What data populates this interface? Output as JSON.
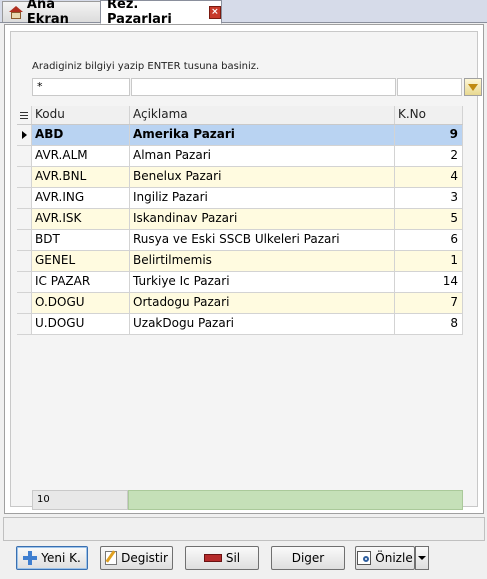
{
  "tabs": [
    {
      "label": "Ana Ekran",
      "icon": "home-icon"
    },
    {
      "label": "Rez. Pazarlari",
      "icon": "close-icon"
    }
  ],
  "search": {
    "hint": "Aradiginiz bilgiyi yazip ENTER tusuna basiniz.",
    "filter1": "*",
    "filter2": "",
    "filter3": ""
  },
  "grid": {
    "columns": [
      "Kodu",
      "Açiklama",
      "K.No"
    ],
    "rows": [
      {
        "kodu": "ABD",
        "aciklama": "Amerika Pazari",
        "kno": "9"
      },
      {
        "kodu": "AVR.ALM",
        "aciklama": "Alman Pazari",
        "kno": "2"
      },
      {
        "kodu": "AVR.BNL",
        "aciklama": "Benelux Pazari",
        "kno": "4"
      },
      {
        "kodu": "AVR.ING",
        "aciklama": "Ingiliz Pazari",
        "kno": "3"
      },
      {
        "kodu": "AVR.ISK",
        "aciklama": "Iskandinav Pazari",
        "kno": "5"
      },
      {
        "kodu": "BDT",
        "aciklama": "Rusya ve Eski SSCB Ulkeleri Pazari",
        "kno": "6"
      },
      {
        "kodu": "GENEL",
        "aciklama": "Belirtilmemis",
        "kno": "1"
      },
      {
        "kodu": "IC PAZAR",
        "aciklama": "Turkiye Ic Pazari",
        "kno": "14"
      },
      {
        "kodu": "O.DOGU",
        "aciklama": "Ortadogu Pazari",
        "kno": "7"
      },
      {
        "kodu": "U.DOGU",
        "aciklama": "UzakDogu Pazari",
        "kno": "8"
      }
    ],
    "footer_count": "10"
  },
  "buttons": {
    "new": "Yeni K.",
    "edit": "Degistir",
    "delete": "Sil",
    "other": "Diger",
    "preview": "Önizle"
  }
}
